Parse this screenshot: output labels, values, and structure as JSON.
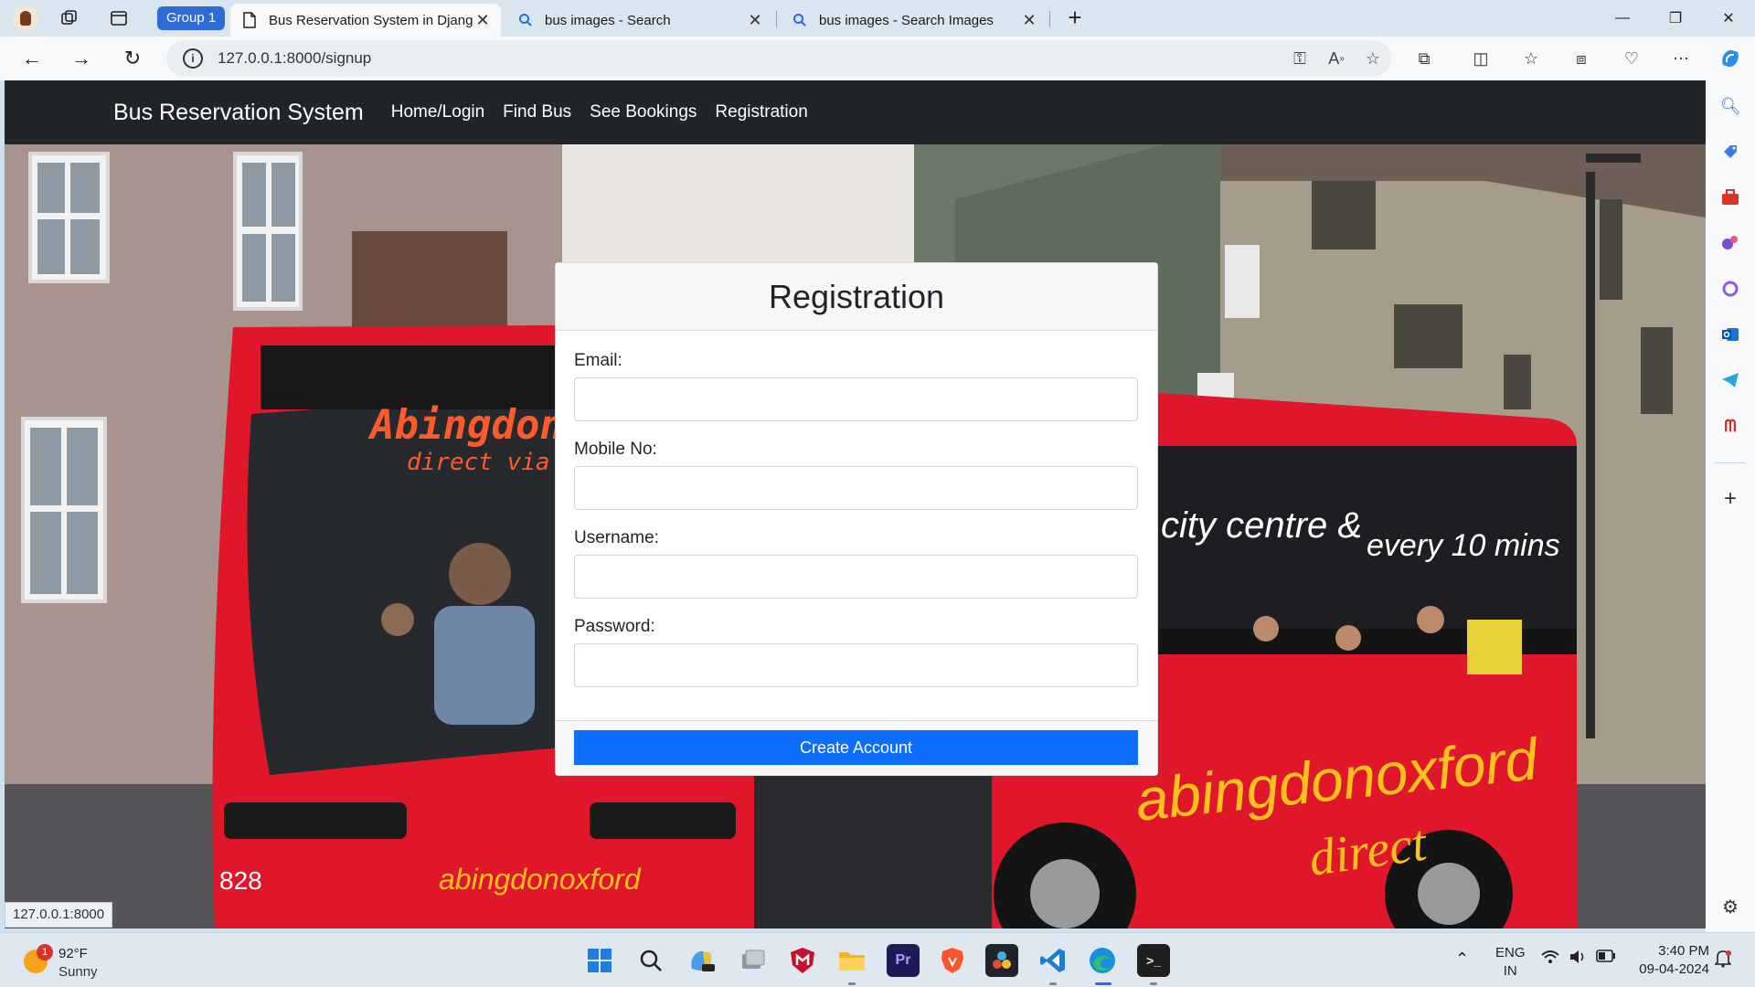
{
  "browser": {
    "tab_group": "Group 1",
    "tabs": [
      {
        "title": "Bus Reservation System in Djang",
        "active": true,
        "icon": "page-icon"
      },
      {
        "title": "bus images - Search",
        "active": false,
        "icon": "search-icon"
      },
      {
        "title": "bus images - Search Images",
        "active": false,
        "icon": "search-icon"
      }
    ],
    "url": "127.0.0.1:8000/signup",
    "status_url": "127.0.0.1:8000"
  },
  "site": {
    "brand": "Bus Reservation System",
    "nav": [
      "Home/Login",
      "Find Bus",
      "See Bookings",
      "Registration"
    ]
  },
  "form": {
    "title": "Registration",
    "fields": [
      {
        "label": "Email:",
        "value": ""
      },
      {
        "label": "Mobile No:",
        "value": ""
      },
      {
        "label": "Username:",
        "value": ""
      },
      {
        "label": "Password:",
        "value": ""
      }
    ],
    "submit_label": "Create Account",
    "submit_color": "#0d6efd"
  },
  "hero_image": {
    "bus_destination_sign": "Abingdon",
    "bus_route_sign": "direct via A",
    "bus_side_text": "city centre &",
    "bus_side_text2": "every 10 mins",
    "bus_brand": "abingdonoxford",
    "bus_brand2": "direct",
    "bus_number": "828",
    "bus_color": "#e0162b"
  },
  "taskbar": {
    "weather_temp": "92°F",
    "weather_condition": "Sunny",
    "weather_badge": "1",
    "language_top": "ENG",
    "language_bottom": "IN",
    "time": "3:40 PM",
    "date": "09-04-2024"
  }
}
